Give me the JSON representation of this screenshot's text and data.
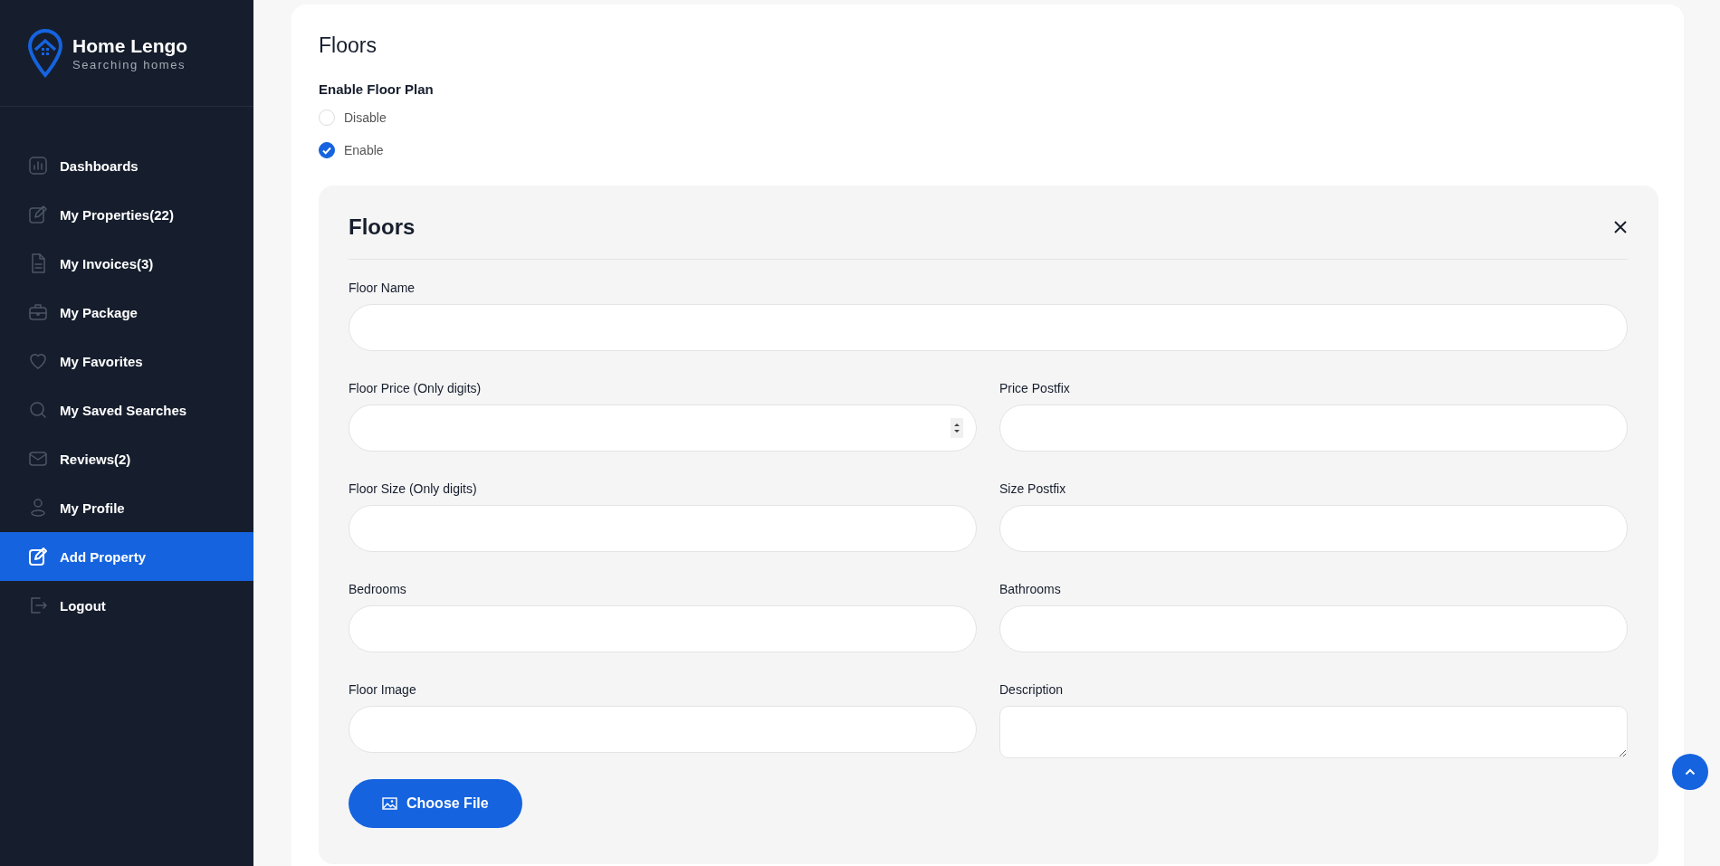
{
  "sidebar": {
    "brand": {
      "name": "Home Lengo",
      "tagline": "Searching homes"
    },
    "items": [
      {
        "label": "Dashboards",
        "selected": false
      },
      {
        "label": "My Properties(22)",
        "selected": false
      },
      {
        "label": "My Invoices(3)",
        "selected": false
      },
      {
        "label": "My Package",
        "selected": false
      },
      {
        "label": "My Favorites",
        "selected": false
      },
      {
        "label": "My Saved Searches",
        "selected": false
      },
      {
        "label": "Reviews(2)",
        "selected": false
      },
      {
        "label": "My Profile",
        "selected": false
      },
      {
        "label": "Add Property",
        "selected": true
      },
      {
        "label": "Logout",
        "selected": false
      }
    ]
  },
  "section": {
    "title": "Floors",
    "floor_plan": {
      "label": "Enable Floor Plan",
      "options": [
        {
          "label": "Disable",
          "selected": false
        },
        {
          "label": "Enable",
          "selected": true
        }
      ]
    },
    "floor_panel": {
      "title": "Floors",
      "rows": [
        [
          {
            "label": "Floor Name",
            "kind": "text"
          }
        ],
        [
          {
            "label": "Floor Price (Only digits)",
            "kind": "number"
          },
          {
            "label": "Price Postfix",
            "kind": "text"
          }
        ],
        [
          {
            "label": "Floor Size (Only digits)",
            "kind": "text"
          },
          {
            "label": "Size Postfix",
            "kind": "text"
          }
        ],
        [
          {
            "label": "Bedrooms",
            "kind": "text"
          },
          {
            "label": "Bathrooms",
            "kind": "text"
          }
        ],
        [
          {
            "label": "Floor Image",
            "kind": "file",
            "button": "Choose File"
          },
          {
            "label": "Description",
            "kind": "textarea"
          }
        ]
      ]
    }
  }
}
